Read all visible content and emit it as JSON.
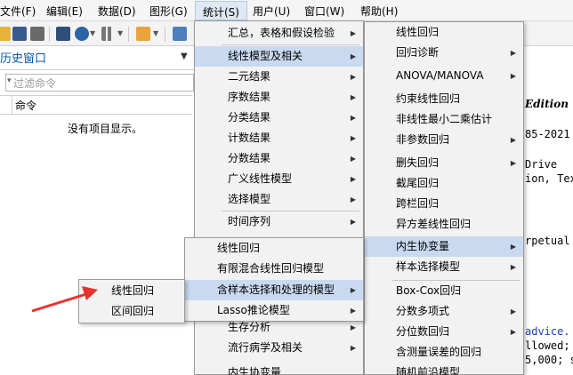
{
  "menubar": {
    "items": [
      "文件(F)",
      "编辑(E)",
      "数据(D)",
      "图形(G)",
      "统计(S)",
      "用户(U)",
      "窗口(W)",
      "帮助(H)"
    ]
  },
  "history": {
    "title": "历史窗口",
    "filter_placeholder": "过滤命令",
    "column_header": "命令",
    "empty_message": "没有项目显示。"
  },
  "output": {
    "edition": "Edition",
    "years": "85-2021",
    "drive": "Drive",
    "city": "ion, Tex",
    "perpetual": "rpetual",
    "advice": "advice.",
    "allowed": "llowed;",
    "vars": "5,000; s"
  },
  "stats_menu": {
    "items": [
      {
        "label": "汇总，表格和假设检验",
        "submenu": true
      },
      {
        "label": "线性模型及相关",
        "submenu": true
      },
      {
        "label": "二元结果",
        "submenu": true
      },
      {
        "label": "序数结果",
        "submenu": true
      },
      {
        "label": "分类结果",
        "submenu": true
      },
      {
        "label": "计数结果",
        "submenu": true
      },
      {
        "label": "分数结果",
        "submenu": true
      },
      {
        "label": "广义线性模型",
        "submenu": true
      },
      {
        "label": "选择模型",
        "submenu": true
      },
      {
        "label": "时间序列",
        "submenu": true
      },
      {
        "label": "生存分析",
        "submenu": true
      },
      {
        "label": "流行病学及相关",
        "submenu": true
      },
      {
        "label": "内生协变量",
        "submenu": true
      }
    ]
  },
  "linear_menu": {
    "items": [
      {
        "label": "线性回归",
        "submenu": false
      },
      {
        "label": "回归诊断",
        "submenu": true
      },
      {
        "label": "ANOVA/MANOVA",
        "submenu": true
      },
      {
        "label": "约束线性回归",
        "submenu": false
      },
      {
        "label": "非线性最小二乘估计",
        "submenu": false
      },
      {
        "label": "非参数回归",
        "submenu": true
      },
      {
        "label": "删失回归",
        "submenu": true
      },
      {
        "label": "截尾回归",
        "submenu": false
      },
      {
        "label": "跨栏回归",
        "submenu": false
      },
      {
        "label": "异方差线性回归",
        "submenu": false
      },
      {
        "label": "内生协变量",
        "submenu": true
      },
      {
        "label": "样本选择模型",
        "submenu": true
      },
      {
        "label": "Box-Cox回归",
        "submenu": false
      },
      {
        "label": "分数多项式",
        "submenu": true
      },
      {
        "label": "分位数回归",
        "submenu": true
      },
      {
        "label": "含测量误差的回归",
        "submenu": false
      },
      {
        "label": "随机前沿模型",
        "submenu": false
      }
    ]
  },
  "endog_menu": {
    "items": [
      {
        "label": "线性回归",
        "submenu": false
      },
      {
        "label": "有限混合线性回归模型",
        "submenu": false
      },
      {
        "label": "含样本选择和处理的模型",
        "submenu": true
      },
      {
        "label": "Lasso推论模型",
        "submenu": true
      }
    ]
  },
  "selection_menu": {
    "items": [
      {
        "label": "线性回归",
        "submenu": false
      },
      {
        "label": "区间回归",
        "submenu": false
      }
    ]
  },
  "colors": {
    "highlight": "#c9daf0",
    "menubar_active": "#dfe8f3",
    "arrow": "#e8322d",
    "history_title": "#0a57a4"
  }
}
